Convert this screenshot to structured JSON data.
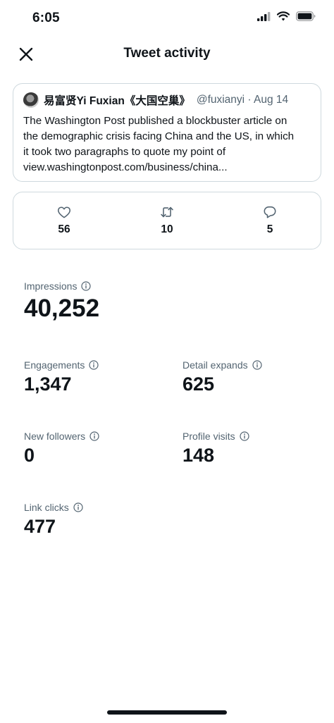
{
  "status_bar": {
    "time": "6:05"
  },
  "header": {
    "title": "Tweet activity"
  },
  "tweet": {
    "author_name": "易富贤Yi Fuxian《大国空巢》",
    "handle_date": "@fuxianyi · Aug 14",
    "lines": [
      "The Washington Post published a blockbuster article on",
      "the demographic crisis facing China and the US, in which",
      "it took two paragraphs to quote my point of",
      "view.washingtonpost.com/business/china..."
    ]
  },
  "engagement_counts": {
    "likes": "56",
    "retweets": "10",
    "replies": "5"
  },
  "metrics": {
    "impressions": {
      "label": "Impressions",
      "value": "40,252"
    },
    "engagements": {
      "label": "Engagements",
      "value": "1,347"
    },
    "detail_expands": {
      "label": "Detail expands",
      "value": "625"
    },
    "new_followers": {
      "label": "New followers",
      "value": "0"
    },
    "profile_visits": {
      "label": "Profile visits",
      "value": "148"
    },
    "link_clicks": {
      "label": "Link clicks",
      "value": "477"
    }
  },
  "icons": {
    "close": "close-icon",
    "like": "heart-icon",
    "retweet": "retweet-icon",
    "reply": "reply-icon",
    "info": "info-icon",
    "signal": "cellular-signal-icon",
    "wifi": "wifi-icon",
    "battery": "battery-icon"
  }
}
